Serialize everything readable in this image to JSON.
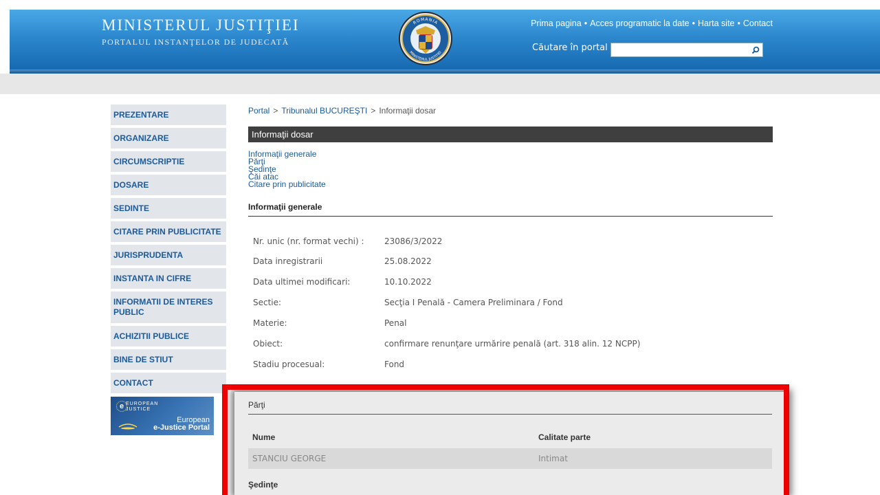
{
  "header": {
    "title": "MINISTERUL JUSTIŢIEI",
    "subtitle": "PORTALUL INSTANŢELOR DE JUDECATĂ",
    "crest_text_top": "ROMANIA",
    "crest_text_bottom": "MINISTERUL JUSTITIEI",
    "links": [
      "Prima pagina",
      "Acces programatic la date",
      "Harta site",
      "Contact"
    ],
    "link_separator": "•",
    "search_label": "Căutare în portal",
    "search_value": ""
  },
  "sidebar": {
    "items": [
      "PREZENTARE",
      "ORGANIZARE",
      "CIRCUMSCRIPTIE",
      "DOSARE",
      "SEDINTE",
      "CITARE PRIN PUBLICITATE",
      "JURISPRUDENTA",
      "INSTANTA IN CIFRE",
      "INFORMATII DE INTERES PUBLIC",
      "ACHIZITII PUBLICE",
      "BINE DE STIUT",
      "CONTACT"
    ],
    "banner": {
      "e_letter": "e",
      "eu_line1": "EUROPEAN",
      "eu_line2": "JUSTICE",
      "line1": "European",
      "line2": "e-Justice Portal"
    }
  },
  "breadcrumb": {
    "items": [
      "Portal",
      "Tribunalul BUCUREŞTI",
      "Informaţii dosar"
    ],
    "separator": ">"
  },
  "main": {
    "section_title": "Informaţii dosar",
    "quick_links": [
      "Informaţii generale",
      "Părţi",
      "Şedinţe",
      "Căi atac",
      "Citare prin publicitate"
    ],
    "general_title": "Informaţii generale",
    "info_rows": [
      {
        "label": "Nr. unic (nr. format vechi) :",
        "value": "23086/3/2022"
      },
      {
        "label": "Data inregistrarii",
        "value": "25.08.2022"
      },
      {
        "label": "Data ultimei modificari:",
        "value": "10.10.2022"
      },
      {
        "label": "Sectie:",
        "value": "Secţia I Penală - Camera Preliminara / Fond"
      },
      {
        "label": "Materie:",
        "value": "Penal"
      },
      {
        "label": "Obiect:",
        "value": "confirmare renunţare urmărire penală (art. 318 alin. 12 NCPP)"
      },
      {
        "label": "Stadiu procesual:",
        "value": "Fond"
      }
    ]
  },
  "parti": {
    "title": "Părţi",
    "columns": [
      "Nume",
      "Calitate parte"
    ],
    "rows": [
      {
        "name": "STANCIU GEORGE",
        "role": "Intimat"
      }
    ],
    "next_section_partial": "Şedinţe"
  },
  "colors": {
    "header_blue": "#2b86cc",
    "link_blue": "#1b5a9b",
    "highlight_red": "#ee0000",
    "section_header_bg": "#3f3f3f"
  }
}
